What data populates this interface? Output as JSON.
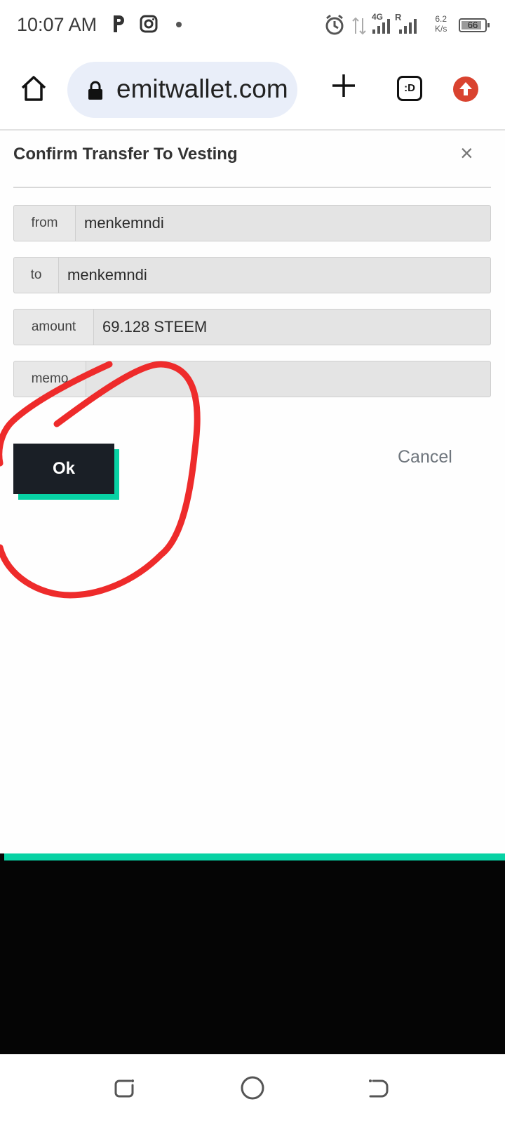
{
  "status_bar": {
    "time": "10:07 AM",
    "net_speed_value": "6.2",
    "net_speed_unit": "K/s",
    "battery_level": "66",
    "network": "4G",
    "roaming": "R"
  },
  "browser": {
    "url": "emitwallet.com",
    "tabs_label": ":D"
  },
  "modal": {
    "title": "Confirm Transfer To Vesting",
    "fields": [
      {
        "label": "from",
        "value": "menkemndi"
      },
      {
        "label": "to",
        "value": "menkemndi"
      },
      {
        "label": "amount",
        "value": "69.128 STEEM"
      },
      {
        "label": "memo",
        "value": ""
      }
    ],
    "ok_label": "Ok",
    "cancel_label": "Cancel"
  },
  "colors": {
    "accent": "#07d2a4",
    "button_dark": "#1a1f26",
    "annotation": "#ee2b2b",
    "update_red": "#d9432f"
  }
}
